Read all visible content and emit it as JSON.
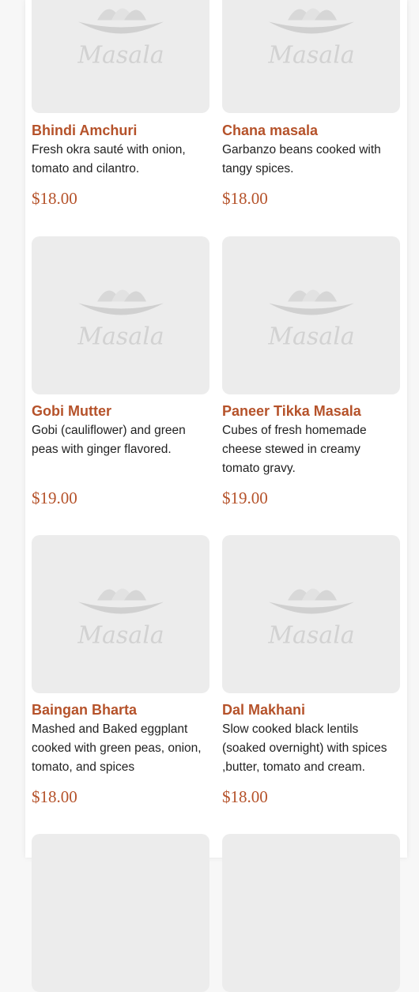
{
  "menu": {
    "placeholder_logo_text": "Masala",
    "items": [
      {
        "name": "Bhindi Amchuri",
        "description": "Fresh okra sauté with onion, tomato and cilantro.",
        "price": "$18.00"
      },
      {
        "name": "Chana masala",
        "description": "Garbanzo beans cooked with tangy spices.",
        "price": "$18.00"
      },
      {
        "name": "Gobi Mutter",
        "description": "Gobi (cauliflower) and green peas with ginger flavored.",
        "price": "$19.00"
      },
      {
        "name": "Paneer Tikka Masala",
        "description": "Cubes of fresh homemade cheese stewed in creamy tomato gravy.",
        "price": "$19.00"
      },
      {
        "name": "Baingan Bharta",
        "description": "Mashed and Baked eggplant cooked with green peas, onion, tomato, and spices",
        "price": "$18.00"
      },
      {
        "name": "Dal Makhani",
        "description": "Slow cooked black lentils (soaked overnight) with spices ,butter, tomato and cream.",
        "price": "$18.00"
      }
    ]
  },
  "colors": {
    "accent": "#b5522a",
    "placeholder_bg": "#ececec",
    "placeholder_art": "#d4d4d4"
  }
}
